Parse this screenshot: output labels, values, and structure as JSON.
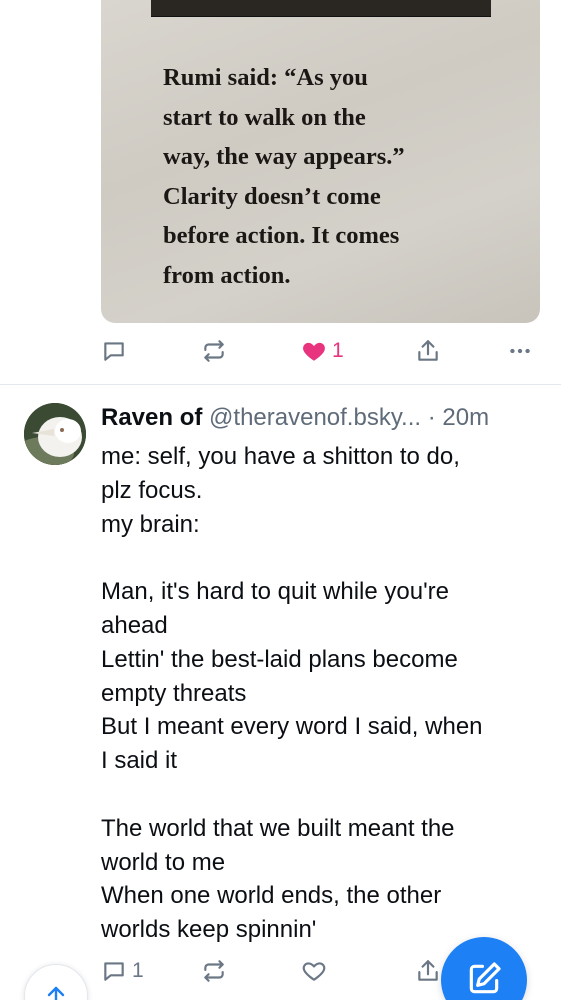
{
  "top_post": {
    "image_quote": "Rumi said: “As you\nstart to walk on the\nway, the way appears.”\nClarity doesn’t come\nbefore action. It comes\nfrom action.",
    "like_count": "1"
  },
  "post": {
    "author_name": "Raven of",
    "author_handle": "@theravenof.bsky...",
    "time_ago": "· 20m",
    "text": "me: self, you have a shitton to do,\nplz focus.\nmy brain:\n\nMan, it's hard to quit while you're\nahead\nLettin' the best-laid plans become\nempty threats\nBut I meant every word I said, when\nI said it\n\nThe world that we built meant the\nworld to me\nWhen one world ends, the other\nworlds keep spinnin'",
    "reply_count": "1"
  },
  "colors": {
    "accent": "#1d80f5",
    "like": "#e8337e",
    "muted": "#6b7785"
  },
  "icons": [
    "reply-icon",
    "repost-icon",
    "heart-icon",
    "share-icon",
    "more-icon",
    "compose-icon",
    "arrow-up-icon"
  ]
}
